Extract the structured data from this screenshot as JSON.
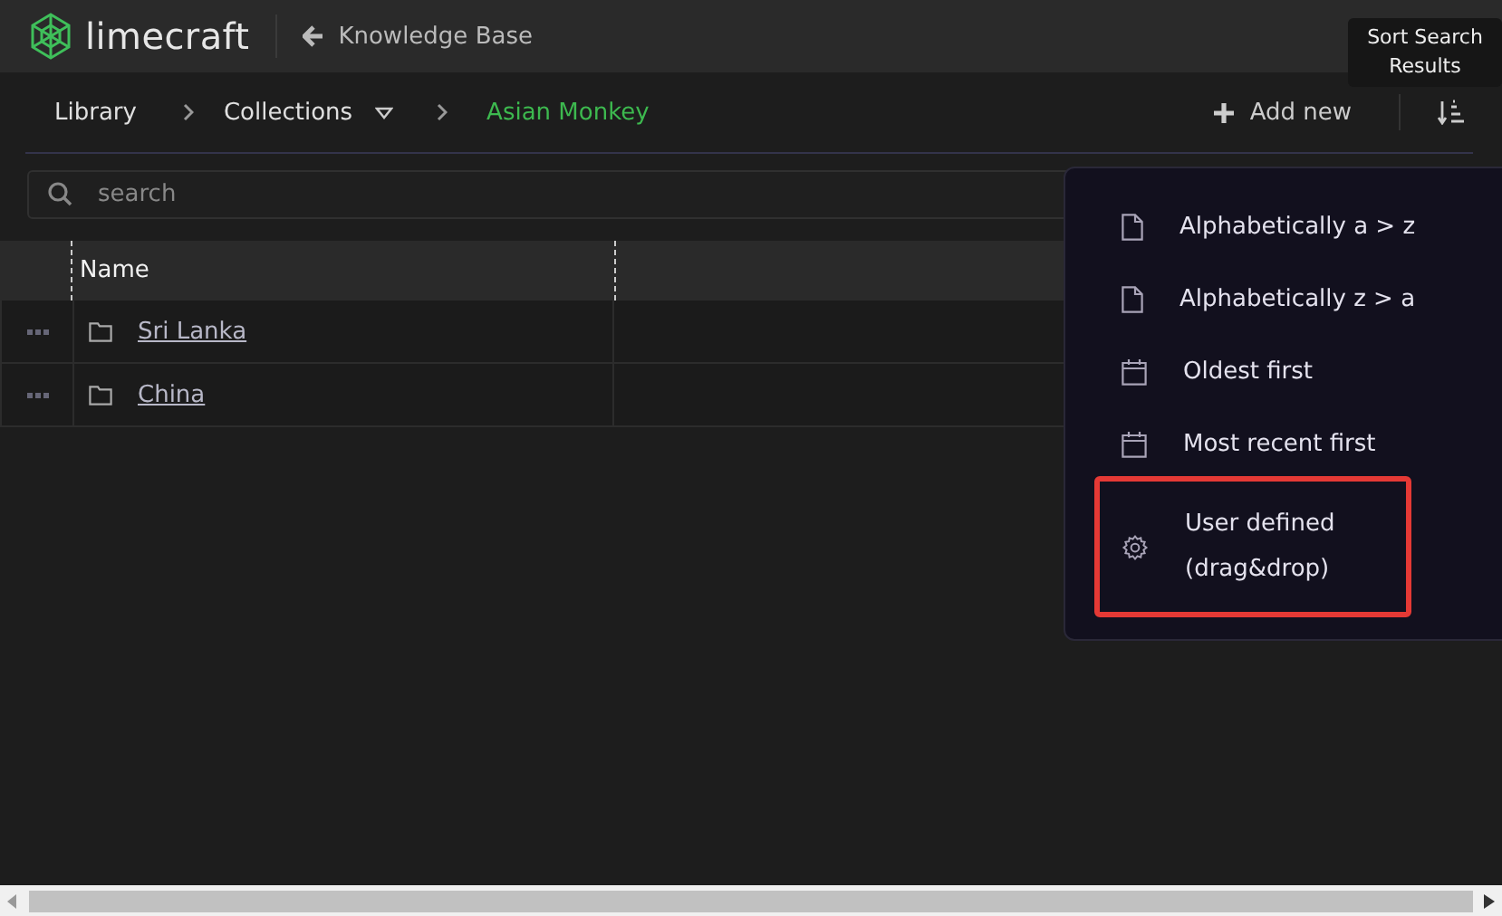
{
  "header": {
    "logo": "limecraft",
    "back_label": "Knowledge Base"
  },
  "breadcrumb": [
    {
      "label": "Library",
      "current": false,
      "dropdown": false
    },
    {
      "label": "Collections",
      "current": false,
      "dropdown": true
    },
    {
      "label": "Asian Monkey",
      "current": true,
      "dropdown": false
    }
  ],
  "toolbar": {
    "add_label": "Add new"
  },
  "tooltip": "Sort Search Results",
  "search": {
    "placeholder": "search"
  },
  "table": {
    "columns": [
      "Name"
    ],
    "rows": [
      {
        "name": "Sri Lanka"
      },
      {
        "name": "China"
      }
    ]
  },
  "sort_menu": [
    {
      "label": "Alphabetically a > z",
      "kind": "document",
      "highlighted": false
    },
    {
      "label": "Alphabetically z > a",
      "kind": "document",
      "highlighted": false
    },
    {
      "label": "Oldest first",
      "kind": "calendar",
      "highlighted": false
    },
    {
      "label": "Most recent first",
      "kind": "calendar",
      "highlighted": false
    },
    {
      "label": "User defined (drag&drop)",
      "kind": "gear",
      "highlighted": true
    }
  ]
}
